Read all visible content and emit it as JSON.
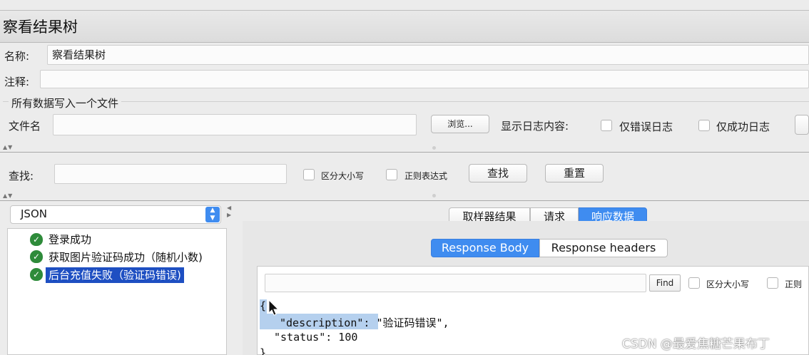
{
  "window": {
    "title": "察看结果树"
  },
  "form": {
    "name_label": "名称:",
    "name_value": "察看结果树",
    "comment_label": "注释:",
    "comment_value": ""
  },
  "file_section": {
    "legend": "所有数据写入一个文件",
    "filename_label": "文件名",
    "filename_value": "",
    "browse_label": "浏览...",
    "log_label": "显示日志内容:",
    "errors_only": "仅错误日志",
    "success_only": "仅成功日志"
  },
  "search": {
    "label": "查找:",
    "value": "",
    "case_sensitive": "区分大小写",
    "regex": "正则表达式",
    "find_button": "查找",
    "reset_button": "重置"
  },
  "renderer": {
    "selected": "JSON"
  },
  "tree": {
    "items": [
      {
        "label": "登录成功",
        "status": "success",
        "selected": false
      },
      {
        "label": "获取图片验证码成功（随机小数)",
        "status": "success",
        "selected": false
      },
      {
        "label": "后台充值失败（验证码错误)",
        "status": "success",
        "selected": true
      }
    ]
  },
  "result_tabs": {
    "sampler_result": "取样器结果",
    "request": "请求",
    "response_data": "响应数据",
    "active": "响应数据"
  },
  "response_tabs": {
    "body": "Response Body",
    "headers": "Response headers",
    "active": "Response Body"
  },
  "response_search": {
    "value": "",
    "find_button": "Find",
    "case_sensitive": "区分大小写",
    "regex_partial": "正则"
  },
  "response_body": {
    "line1": "{",
    "line2_key": "\"description\"",
    "line2_colon": ": ",
    "line2_value": "\"验证码错误\",",
    "line3": "\"status\": 100",
    "line4": "}"
  },
  "watermark": "CSDN @最爱焦糖芒果布丁",
  "colors": {
    "accent": "#3f8cf0",
    "tree_selected": "#1e4fc2",
    "success_icon": "#2e8b3a",
    "highlight": "#b5d0ee"
  }
}
